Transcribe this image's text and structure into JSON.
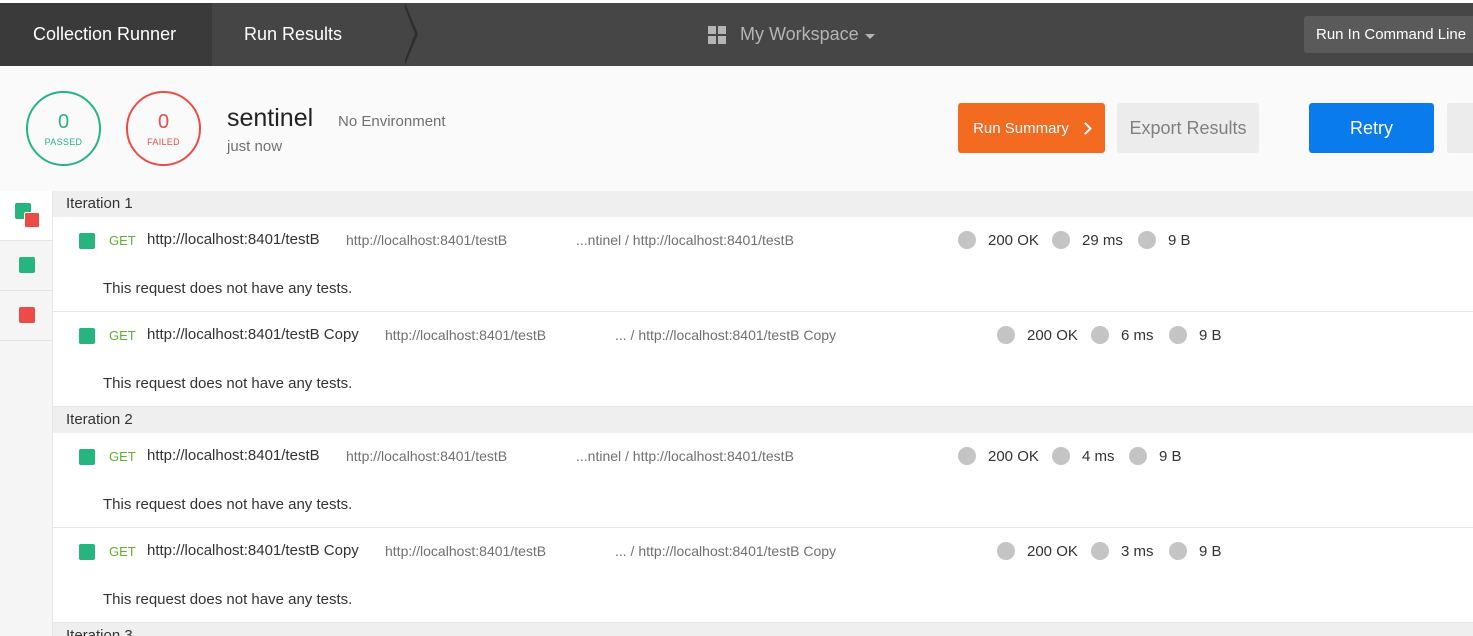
{
  "nav": {
    "crumbs": [
      "Collection Runner",
      "Run Results"
    ],
    "workspace": "My Workspace",
    "command_line_button": "Run In Command Line"
  },
  "summary": {
    "passed_count": "0",
    "passed_label": "PASSED",
    "failed_count": "0",
    "failed_label": "FAILED",
    "collection_name": "sentinel",
    "environment": "No Environment",
    "run_time": "just now",
    "run_summary_button": "Run Summary",
    "export_button": "Export Results",
    "retry_button": "Retry"
  },
  "colors": {
    "pass": "#26b47f",
    "fail": "#ed4b48",
    "accent_orange": "#f26b21",
    "accent_blue": "#097bed",
    "method_get": "#5db02f"
  },
  "rail": {
    "items": [
      {
        "icon": "green-red-stack-icon"
      },
      {
        "icon": "green-square-icon"
      },
      {
        "icon": "red-square-icon"
      }
    ]
  },
  "iterations": [
    {
      "label": "Iteration 1",
      "requests": [
        {
          "method": "GET",
          "name": "http://localhost:8401/testB",
          "url": "http://localhost:8401/testB",
          "path": "...ntinel / http://localhost:8401/testB",
          "status": "200 OK",
          "time": "29 ms",
          "size": "9 B",
          "tests_note": "This request does not have any tests."
        },
        {
          "method": "GET",
          "name": "http://localhost:8401/testB Copy",
          "url": "http://localhost:8401/testB",
          "path": "... / http://localhost:8401/testB Copy",
          "status": "200 OK",
          "time": "6 ms",
          "size": "9 B",
          "tests_note": "This request does not have any tests."
        }
      ]
    },
    {
      "label": "Iteration 2",
      "requests": [
        {
          "method": "GET",
          "name": "http://localhost:8401/testB",
          "url": "http://localhost:8401/testB",
          "path": "...ntinel / http://localhost:8401/testB",
          "status": "200 OK",
          "time": "4 ms",
          "size": "9 B",
          "tests_note": "This request does not have any tests."
        },
        {
          "method": "GET",
          "name": "http://localhost:8401/testB Copy",
          "url": "http://localhost:8401/testB",
          "path": "... / http://localhost:8401/testB Copy",
          "status": "200 OK",
          "time": "3 ms",
          "size": "9 B",
          "tests_note": "This request does not have any tests."
        }
      ]
    },
    {
      "label": "Iteration 3",
      "requests": []
    }
  ]
}
